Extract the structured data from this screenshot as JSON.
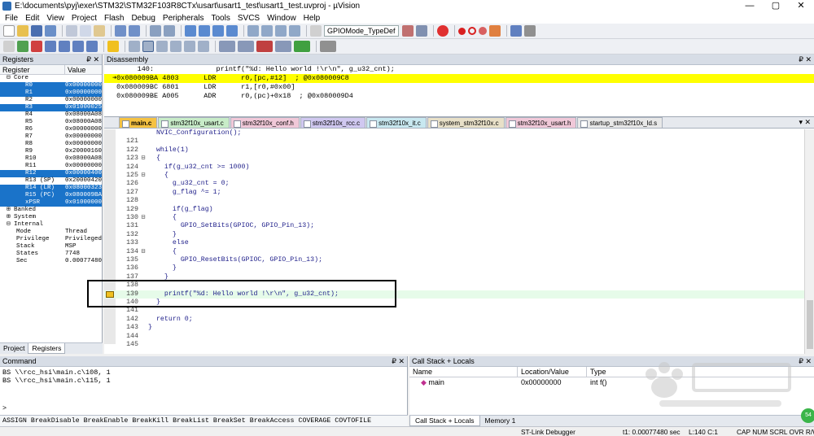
{
  "window": {
    "title": "E:\\documents\\pyj\\exer\\STM32\\STM32F103R8CTx\\usart\\usart1_test\\usart1_test.uvproj - µVision",
    "minimize": "—",
    "maximize": "▢",
    "close": "✕"
  },
  "menu": [
    "File",
    "Edit",
    "View",
    "Project",
    "Flash",
    "Debug",
    "Peripherals",
    "Tools",
    "SVCS",
    "Window",
    "Help"
  ],
  "toolbar": {
    "target_combo": "GPIOMode_TypeDef"
  },
  "registers": {
    "title": "Registers",
    "pin": "₽ ✕",
    "col_register": "Register",
    "col_value": "Value",
    "rows": [
      {
        "name": "⊟ Core",
        "value": "",
        "kind": "grp"
      },
      {
        "name": "R0",
        "value": "0x00000000",
        "sel": true
      },
      {
        "name": "R1",
        "value": "0x00000000",
        "sel": true
      },
      {
        "name": "R2",
        "value": "0x00000000"
      },
      {
        "name": "R3",
        "value": "0x01000025",
        "sel": true
      },
      {
        "name": "R4",
        "value": "0x08000A08"
      },
      {
        "name": "R5",
        "value": "0x08000A08"
      },
      {
        "name": "R6",
        "value": "0x00000000"
      },
      {
        "name": "R7",
        "value": "0x00000000"
      },
      {
        "name": "R8",
        "value": "0x00000000"
      },
      {
        "name": "R9",
        "value": "0x20000160"
      },
      {
        "name": "R10",
        "value": "0x08000A08"
      },
      {
        "name": "R11",
        "value": "0x00000000"
      },
      {
        "name": "R12",
        "value": "0x00000400",
        "sel": true
      },
      {
        "name": "R13 (SP)",
        "value": "0x20000420"
      },
      {
        "name": "R14 (LR)",
        "value": "0x08000323",
        "sel": true
      },
      {
        "name": "R15 (PC)",
        "value": "0x080009BA",
        "sel": true
      },
      {
        "name": "xPSR",
        "value": "0x01000000",
        "sel": true
      },
      {
        "name": "⊞ Banked",
        "value": "",
        "kind": "grp"
      },
      {
        "name": "⊞ System",
        "value": "",
        "kind": "grp"
      },
      {
        "name": "⊟ Internal",
        "value": "",
        "kind": "grp"
      },
      {
        "name": "Mode",
        "value": "Thread",
        "kind": "grp2"
      },
      {
        "name": "Privilege",
        "value": "Privileged",
        "kind": "grp2"
      },
      {
        "name": "Stack",
        "value": "MSP",
        "kind": "grp2"
      },
      {
        "name": "States",
        "value": "7748",
        "kind": "grp2"
      },
      {
        "name": "Sec",
        "value": "0.00077480",
        "kind": "grp2"
      }
    ],
    "tab_project": "Project",
    "tab_registers": "Registers"
  },
  "disassembly": {
    "title": "Disassembly",
    "ctl": "₽ ✕",
    "lines": [
      "      140:               printf(\"%d: Hello world !\\r\\n\", g_u32_cnt);",
      "➜0x080009BA 4803      LDR      r0,[pc,#12]  ; @0x080009C8",
      " 0x080009BC 6801      LDR      r1,[r0,#0x00]",
      " 0x080009BE A005      ADR      r0,(pc)+0x18  ; @0x080009D4"
    ]
  },
  "editor": {
    "tabs": [
      "main.c",
      "stm32f10x_usart.c",
      "stm32f10x_conf.h",
      "stm32f10x_rcc.c",
      "stm32f10x_it.c",
      "system_stm32f10x.c",
      "stm32f10x_usart.h",
      "startup_stm32f10x_ld.s"
    ],
    "active_tab": "main.c",
    "tab_close": "▾ ✕",
    "lines": [
      {
        "n": "",
        "f": "",
        "t": "  NVIC_Configuration();"
      },
      {
        "n": "121",
        "f": "",
        "t": ""
      },
      {
        "n": "122",
        "f": "",
        "t": "  while(1)"
      },
      {
        "n": "123",
        "f": "⊟",
        "t": "  {"
      },
      {
        "n": "124",
        "f": "",
        "t": "    if(g_u32_cnt >= 1000)"
      },
      {
        "n": "125",
        "f": "⊟",
        "t": "    {"
      },
      {
        "n": "126",
        "f": "",
        "t": "      g_u32_cnt = 0;"
      },
      {
        "n": "127",
        "f": "",
        "t": "      g_flag ^= 1;"
      },
      {
        "n": "128",
        "f": "",
        "t": ""
      },
      {
        "n": "129",
        "f": "",
        "t": "      if(g_flag)"
      },
      {
        "n": "130",
        "f": "⊟",
        "t": "      {"
      },
      {
        "n": "131",
        "f": "",
        "t": "        GPIO_SetBits(GPIOC, GPIO_Pin_13);"
      },
      {
        "n": "132",
        "f": "",
        "t": "      }"
      },
      {
        "n": "133",
        "f": "",
        "t": "      else"
      },
      {
        "n": "134",
        "f": "⊟",
        "t": "      {"
      },
      {
        "n": "135",
        "f": "",
        "t": "        GPIO_ResetBits(GPIOC, GPIO_Pin_13);"
      },
      {
        "n": "136",
        "f": "",
        "t": "      }"
      },
      {
        "n": "137",
        "f": "",
        "t": "    }"
      },
      {
        "n": "138",
        "f": "",
        "t": ""
      },
      {
        "n": "139",
        "f": "",
        "t": "    printf(\"%d: Hello world !\\r\\n\", g_u32_cnt);"
      },
      {
        "n": "140",
        "f": "",
        "t": "  }"
      },
      {
        "n": "141",
        "f": "",
        "t": ""
      },
      {
        "n": "142",
        "f": "",
        "t": "  return 0;"
      },
      {
        "n": "143",
        "f": "",
        "t": "}"
      },
      {
        "n": "144",
        "f": "",
        "t": ""
      },
      {
        "n": "145",
        "f": "",
        "t": ""
      }
    ],
    "current_line_index": 19
  },
  "command": {
    "title": "Command",
    "ctl": "₽ ✕",
    "lines": [
      "BS \\\\rcc_hsi\\main.c\\108, 1",
      "BS \\\\rcc_hsi\\main.c\\115, 1"
    ],
    "prompt": ">",
    "help": "ASSIGN BreakDisable BreakEnable BreakKill BreakList BreakSet BreakAccess COVERAGE COVTOFILE"
  },
  "callstack": {
    "title": "Call Stack + Locals",
    "ctl": "₽ ✕",
    "col_name": "Name",
    "col_location": "Location/Value",
    "col_type": "Type",
    "row": {
      "name": "main",
      "location": "0x00000000",
      "type": "int f()"
    },
    "tab_callstack": "Call Stack + Locals",
    "tab_memory": "Memory 1"
  },
  "status": {
    "debugger": "ST-Link Debugger",
    "time": "t1: 0.00077480 sec",
    "position": "L:140 C:1",
    "indicators": "CAP  NUM  SCRL  OVR  R/W",
    "badge": "54"
  },
  "colors": {
    "highlight_yellow": "#ffff00",
    "selection_blue": "#1a73c9",
    "current_line": "#e6fbe9"
  }
}
